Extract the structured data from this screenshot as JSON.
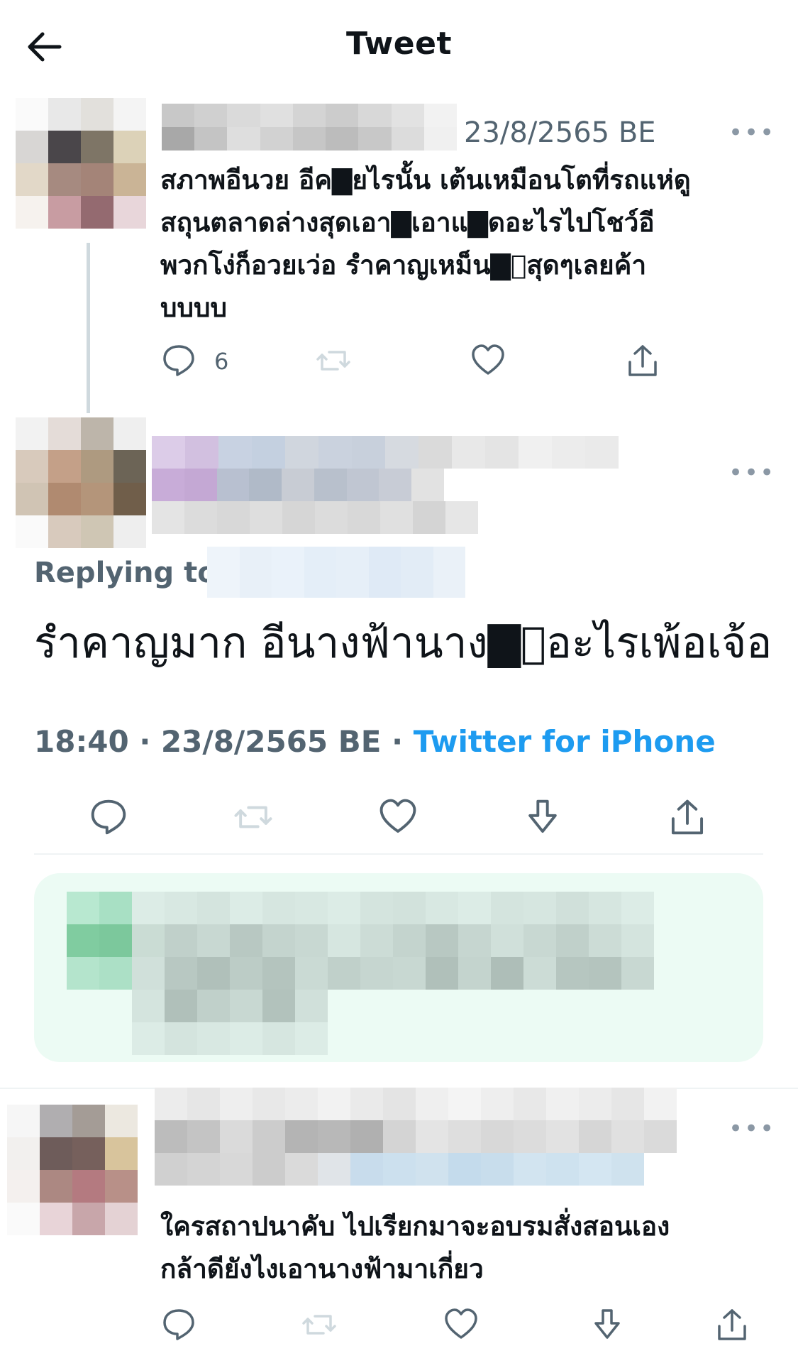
{
  "header": {
    "title": "Tweet",
    "back_icon": "arrow-left-icon"
  },
  "parent_tweet": {
    "date": "23/8/2565 BE",
    "text_lines": [
      "สภาพอีนวย อีค▇ยไรนั้น เต้นเหมือนโตที่รถแห่ดู",
      "สถุนตลาดล่างสุดเอา▇เอาแ▇ดอะไรไปโชว์อี",
      "พวกโง่ก็อวยเว่อ รำคาญเหม็น▇ีสุดๆเลยค้า",
      "บบบบ"
    ],
    "reply_count": "6",
    "more": "•••"
  },
  "focused_tweet": {
    "replying_label": "Replying to",
    "text": "รำคาญมาก อีนางฟ้านาง▇ีอะไรเพ้อเจ้อ",
    "time": "18:40",
    "sep": " · ",
    "date": "23/8/2565 BE",
    "source": "Twitter for iPhone",
    "more": "•••"
  },
  "reply_tweet": {
    "text_lines": [
      "ใครสถาปนาคับ ไปเรียกมาจะอบรมสั่งสอนเอง",
      "กล้าดียังไงเอานางฟ้ามาเกี่ยว"
    ],
    "more": "•••"
  },
  "colors": {
    "accent": "#1d9bf0",
    "muted": "#536471",
    "icon": "#536471",
    "promo_bg": "#ecfbf4"
  },
  "icons": [
    "reply-icon",
    "retweet-icon",
    "like-icon",
    "bookmark-icon",
    "share-icon"
  ]
}
